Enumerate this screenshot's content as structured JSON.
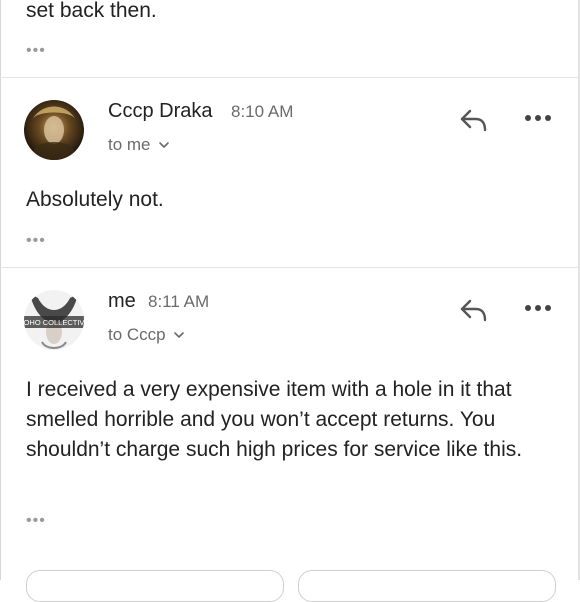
{
  "thread": {
    "previous_fragment": "set back then.",
    "messages": [
      {
        "sender": "Cccp Draka",
        "time": "8:10 AM",
        "recipient": "to me",
        "body": "Absolutely not."
      },
      {
        "sender": "me",
        "time": "8:11 AM",
        "recipient": "to Cccp",
        "avatar_text": "OHO COLLECTIV",
        "body": "I received a very expensive item with a hole in it that smelled horrible and you won’t accept returns. You shouldn’t charge such high prices for service like this."
      }
    ],
    "ellipsis_label": "•••"
  },
  "icons": {
    "reply": "reply-arrow-icon",
    "more": "more-horizontal-icon",
    "chevron": "chevron-down-icon"
  },
  "colors": {
    "text": "#222222",
    "secondary": "#6b6b6b",
    "divider": "#e3e3e3",
    "ellipsis": "#9a9a9a"
  }
}
